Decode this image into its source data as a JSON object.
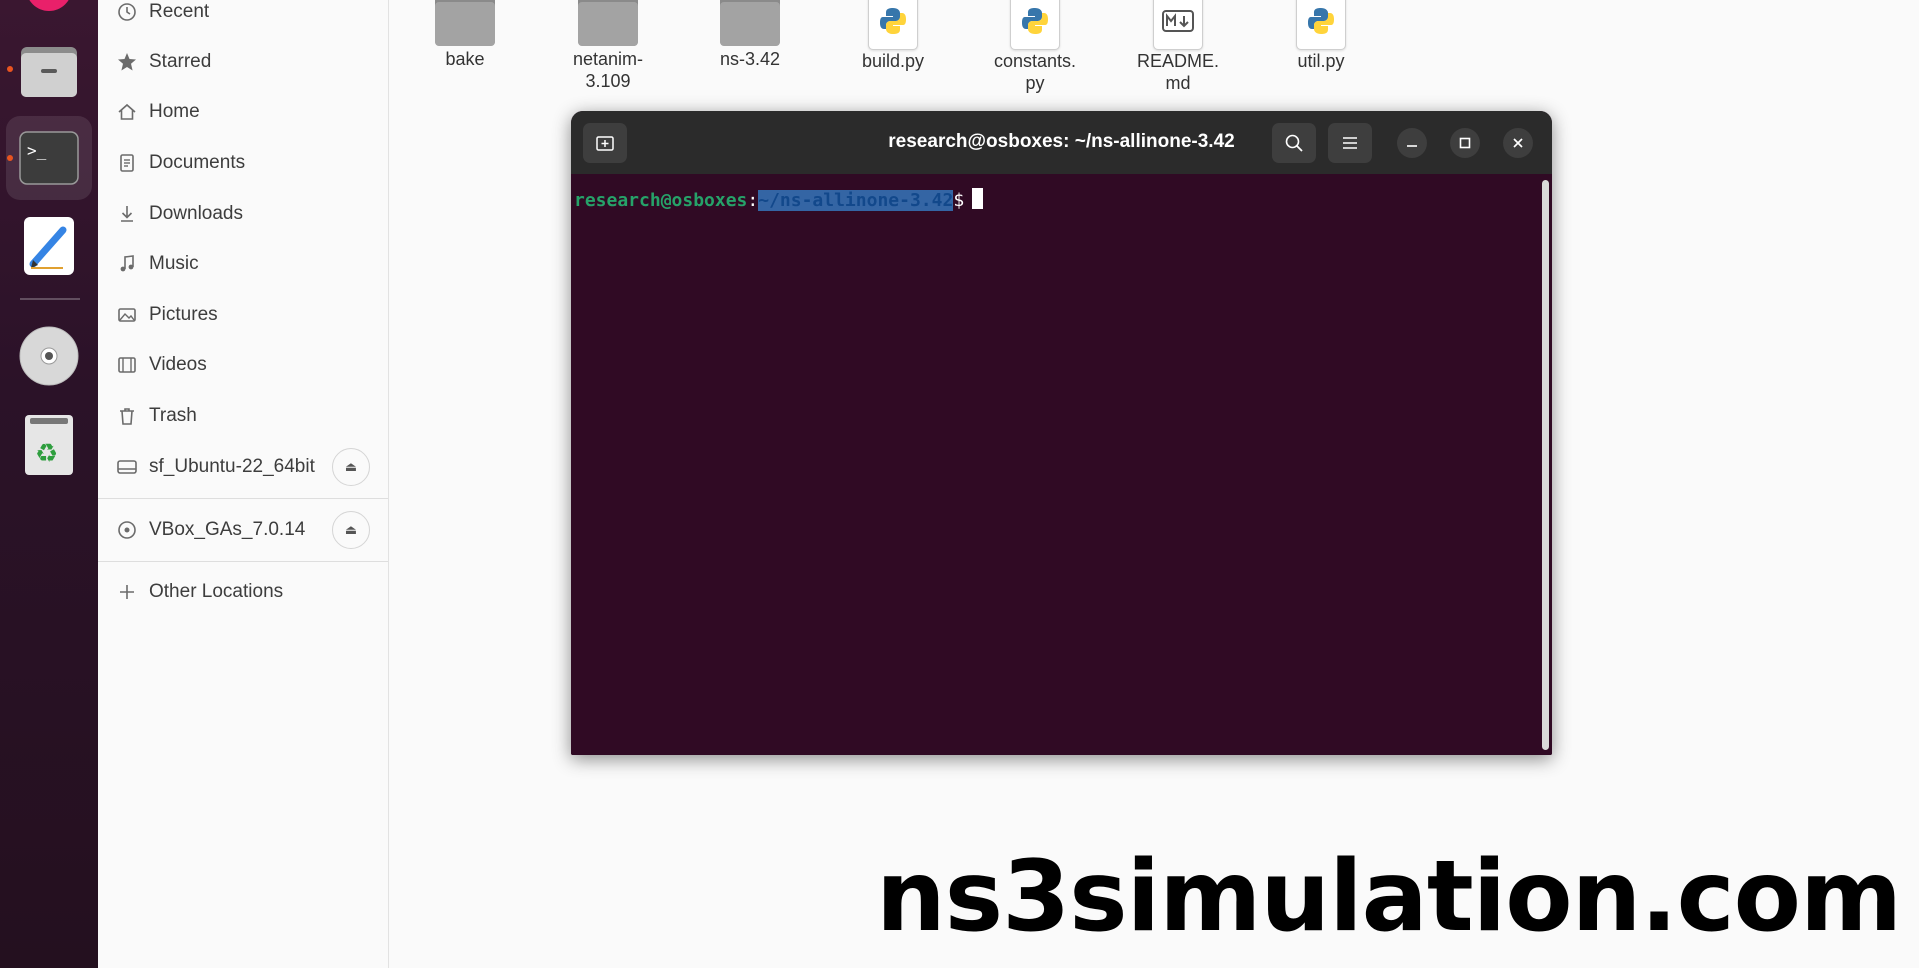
{
  "sidebar": {
    "items": [
      {
        "label": "Recent",
        "icon": "clock-icon"
      },
      {
        "label": "Starred",
        "icon": "star-icon"
      },
      {
        "label": "Home",
        "icon": "home-icon"
      },
      {
        "label": "Documents",
        "icon": "document-icon"
      },
      {
        "label": "Downloads",
        "icon": "download-icon"
      },
      {
        "label": "Music",
        "icon": "music-icon"
      },
      {
        "label": "Pictures",
        "icon": "picture-icon"
      },
      {
        "label": "Videos",
        "icon": "video-icon"
      },
      {
        "label": "Trash",
        "icon": "trash-icon"
      }
    ],
    "devices": [
      {
        "label": "sf_Ubuntu-22_64bit",
        "icon": "drive-icon"
      },
      {
        "label": "VBox_GAs_7.0.14",
        "icon": "disc-icon"
      }
    ],
    "other_locations": "Other Locations"
  },
  "files": [
    {
      "name": "bake",
      "type": "folder"
    },
    {
      "name": "netanim-\n3.109",
      "type": "folder"
    },
    {
      "name": "ns-3.42",
      "type": "folder"
    },
    {
      "name": "build.py",
      "type": "python"
    },
    {
      "name": "constants.\npy",
      "type": "python"
    },
    {
      "name": "README.\nmd",
      "type": "markdown"
    },
    {
      "name": "util.py",
      "type": "python"
    }
  ],
  "terminal": {
    "title": "research@osboxes: ~/ns-allinone-3.42",
    "prompt_user": "research@osboxes",
    "prompt_colon": ":",
    "prompt_path": "~/ns-allinone-3.42",
    "prompt_dollar": "$"
  },
  "watermark": "ns3simulation.com",
  "colors": {
    "terminal_bg": "#300a24",
    "prompt_user": "#26a269",
    "selection": "#3465a4",
    "accent": "#e95420"
  }
}
